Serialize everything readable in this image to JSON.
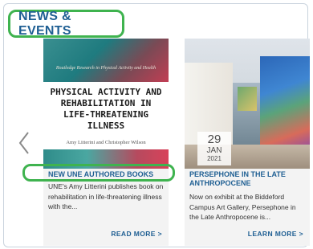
{
  "section": {
    "title": "NEWS & EVENTS"
  },
  "carousel": {
    "prev_icon": "chevron-left-icon"
  },
  "cards": [
    {
      "book": {
        "series": "Routledge Research in Physical Activity and Health",
        "title": "PHYSICAL ACTIVITY AND REHABILITATION IN LIFE-THREATENING ILLNESS",
        "authors": "Amy Litterini and Christopher Wilson"
      },
      "heading": "NEW UNE AUTHORED BOOKS",
      "excerpt": "UNE's Amy Litterini publishes book on rehabilitation in life-threatening illness with the...",
      "link": "READ MORE >"
    },
    {
      "date": {
        "day": "29",
        "month": "JAN",
        "year": "2021"
      },
      "heading": "PERSEPHONE IN THE LATE ANTHROPOCENE",
      "excerpt": "Now on exhibit at the Biddeford Campus Art Gallery, Persephone in the Late Anthropocene is...",
      "link": "LEARN MORE >"
    }
  ],
  "colors": {
    "accent_blue": "#1f5f93",
    "highlight_green": "#3fb34f"
  }
}
